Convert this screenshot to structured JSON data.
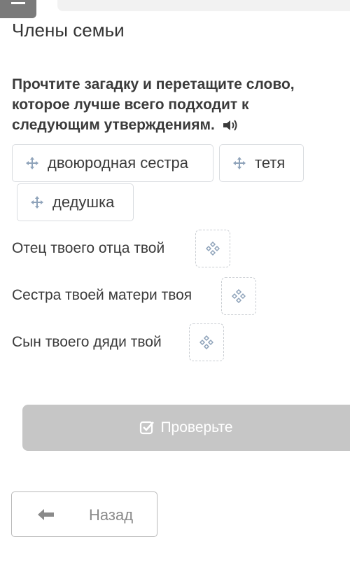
{
  "page": {
    "title": "Члены семьи"
  },
  "task": {
    "instructions": "Прочтите загадку и перетащите слово, которое лучше всего подходит к следующим утверждениям."
  },
  "options": [
    {
      "label": "двоюродная сестра"
    },
    {
      "label": "тетя"
    },
    {
      "label": "дедушка"
    }
  ],
  "statements": [
    {
      "text": "Отец твоего отца твой"
    },
    {
      "text": "Сестра твоей матери твоя"
    },
    {
      "text": "Сын твоего дяди твой"
    }
  ],
  "buttons": {
    "check_label": "Проверьте",
    "back_label": "Назад"
  },
  "icons": {
    "menu": "menu-icon",
    "audio": "speaker-icon",
    "move": "move-icon",
    "check": "checkbox-icon",
    "back": "arrow-left-icon"
  },
  "colors": {
    "check_button_bg": "#c6c6c6",
    "chip_border": "#d9dce0",
    "move_icon": "#8fa3ba",
    "text": "#3b3b3b"
  }
}
